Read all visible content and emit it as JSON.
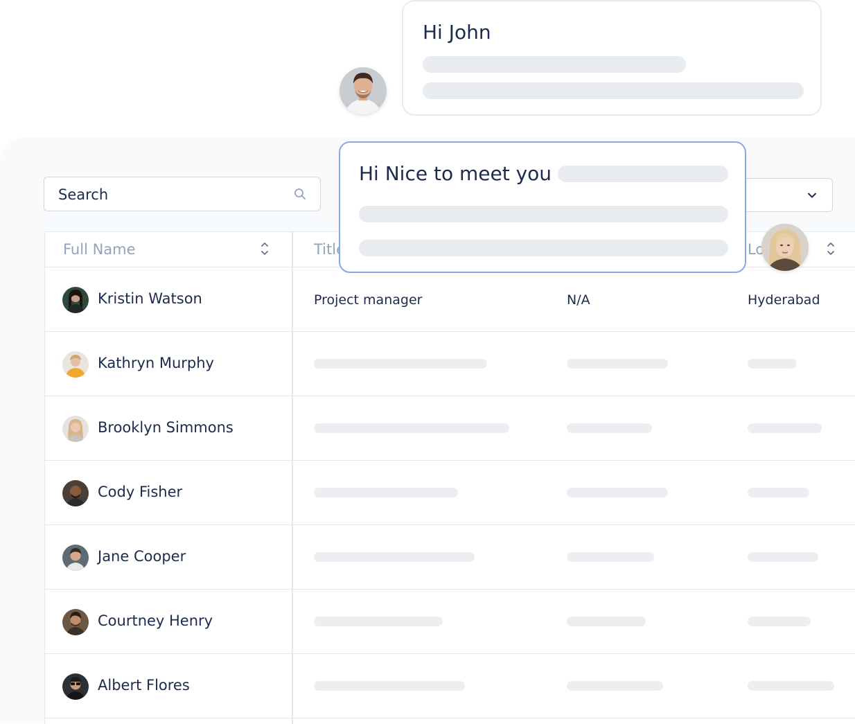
{
  "search": {
    "label": "Search"
  },
  "table": {
    "headers": {
      "full_name": "Full Name",
      "title": "Title",
      "location": "Location"
    },
    "rows": [
      {
        "name": "Kristin Watson",
        "title": "Project manager",
        "status": "N/A",
        "location": "Hyderabad"
      },
      {
        "name": "Kathryn Murphy"
      },
      {
        "name": "Brooklyn Simmons"
      },
      {
        "name": "Cody Fisher"
      },
      {
        "name": "Jane Cooper"
      },
      {
        "name": "Courtney Henry"
      },
      {
        "name": "Albert Flores"
      }
    ]
  },
  "chat": {
    "message_1": "Hi John",
    "message_2": "Hi Nice to meet you"
  },
  "colors": {
    "text_primary": "#1b2a4e",
    "header_text": "#94a3b8",
    "bubble_accent_border": "#86a8e7",
    "skeleton": "#eceef1",
    "border": "#e2e8f0"
  }
}
